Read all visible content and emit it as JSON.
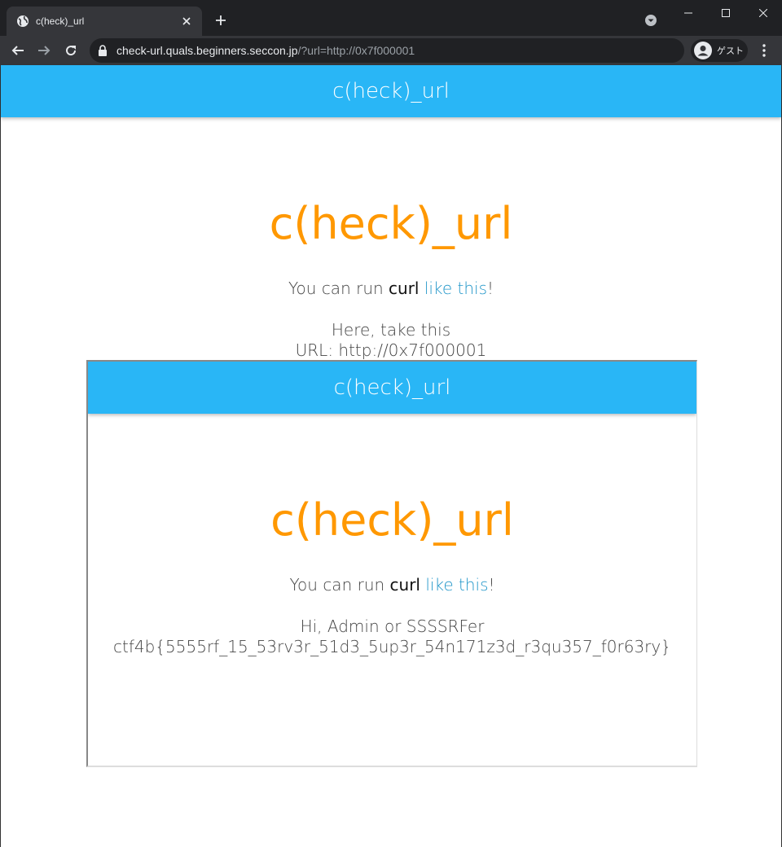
{
  "browser": {
    "tab_title": "c(heck)_url",
    "url_host": "check-url.quals.beginners.seccon.jp",
    "url_rest": "/?url=http://0x7f000001",
    "profile_label": "ゲスト"
  },
  "page": {
    "appbar_title": "c(heck)_url",
    "heading": "c(heck)_url",
    "intro_prefix": "You can run ",
    "intro_cmd": "curl",
    "intro_link": "like this",
    "intro_suffix": "!",
    "take_line": "Here, take this",
    "url_line": "URL: http://0x7f000001"
  },
  "frame": {
    "appbar_title": "c(heck)_url",
    "heading": "c(heck)_url",
    "intro_prefix": "You can run ",
    "intro_cmd": "curl",
    "intro_link": "like this",
    "intro_suffix": "!",
    "greeting": "Hi, Admin or SSSSRFer",
    "flag": "ctf4b{5555rf_15_53rv3r_51d3_5up3r_54n171z3d_r3qu357_f0r63ry}"
  },
  "colors": {
    "appbar": "#29b6f6",
    "heading": "#ff9800",
    "link": "#2196c9"
  }
}
